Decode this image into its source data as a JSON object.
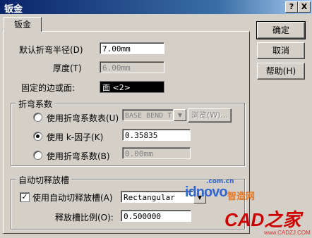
{
  "window": {
    "title": "钣金",
    "help_btn": "?",
    "close_btn": "X"
  },
  "tab": {
    "label": "钣金"
  },
  "buttons": {
    "ok": "确定",
    "cancel": "取消",
    "help": "帮助(H)"
  },
  "fields": {
    "bend_radius_label": "默认折弯半径(D)",
    "bend_radius_value": "7.00mm",
    "thickness_label": "厚度(T)",
    "thickness_value": "6.00mm",
    "fixed_face_label": "固定的边或面:",
    "fixed_face_value": "面 <2>"
  },
  "bend_group": {
    "title": "折弯系数",
    "table_option": "使用折弯系数表(U)",
    "table_value": "BASE BEND T",
    "browse": "浏览(W)...",
    "kfactor_option": "使用 k-因子(K)",
    "kfactor_value": "0.35835",
    "allowance_option": "使用折弯系数(B)",
    "allowance_value": "0.00mm",
    "selected": "kfactor"
  },
  "relief_group": {
    "title": "自动切释放槽",
    "enable_label": "使用自动切释放槽(A)",
    "enabled": true,
    "type_value": "Rectangular",
    "ratio_label": "释放槽比例(O):",
    "ratio_value": "0.500000"
  },
  "watermarks": {
    "site1_domain": ".com.cn",
    "site1_name": "idnovo",
    "site1_cn": "智造网",
    "site2_logo": "CAD之家",
    "site2_url": "www.CADZJ.COM"
  }
}
